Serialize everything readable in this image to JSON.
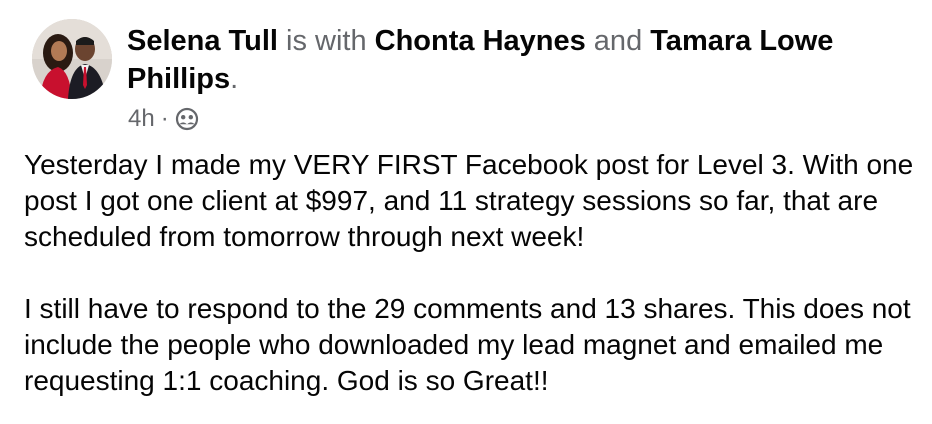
{
  "post": {
    "author": "Selena Tull",
    "with_text": " is with ",
    "tagged_1": "Chonta Haynes",
    "and_text": " and ",
    "tagged_2": "Tamara Lowe Phillips",
    "period": ".",
    "timestamp": "4h",
    "separator": "·",
    "audience_icon": "friends-icon",
    "paragraphs": [
      "Yesterday I made my VERY FIRST Facebook post for Level 3. With one post I got one client at $997, and 11 strategy sessions so far, that are scheduled from tomorrow through next week!",
      "I still have to respond to the 29 comments and 13 shares. This does not include the people who downloaded my lead magnet and emailed me requesting 1:1 coaching. God is so Great!!"
    ]
  },
  "colors": {
    "text": "#050505",
    "muted": "#65676b",
    "avatar_ring": "#e9e6e2"
  }
}
